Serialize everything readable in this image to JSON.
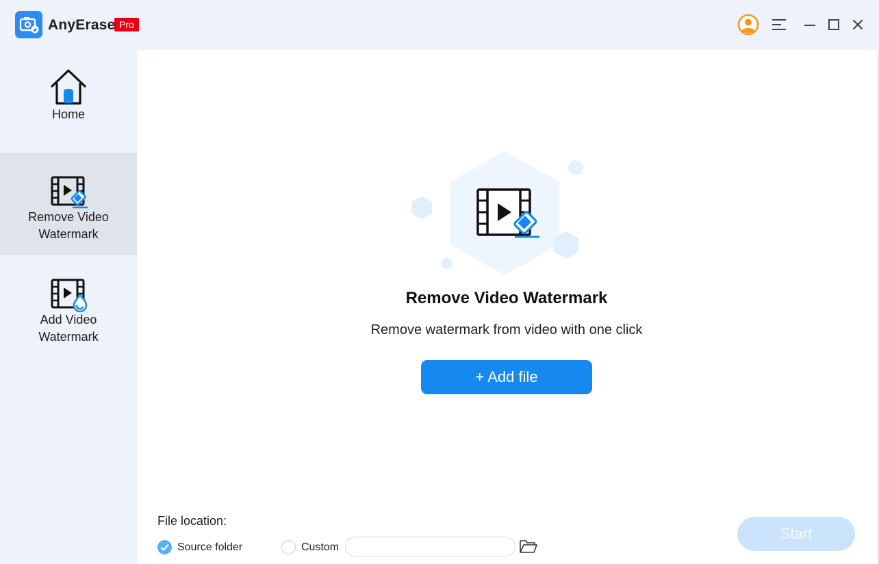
{
  "app": {
    "name": "AnyErase",
    "badge": "Pro"
  },
  "titlebar": {
    "icons": [
      "account-icon",
      "menu-icon",
      "minimize-icon",
      "maximize-icon",
      "close-icon"
    ]
  },
  "sidebar": {
    "items": [
      {
        "label": "Home",
        "icon": "home-icon",
        "active": false
      },
      {
        "label": "Remove Video\nWatermark",
        "icon": "remove-watermark-icon",
        "active": true
      },
      {
        "label": "Add Video\nWatermark",
        "icon": "add-watermark-icon",
        "active": false
      }
    ]
  },
  "main": {
    "title": "Remove Video Watermark",
    "subtitle": "Remove watermark from video with one click",
    "add_file_label": "+ Add file",
    "file_location_label": "File location:",
    "source_folder_label": "Source folder",
    "custom_label": "Custom",
    "custom_path_value": "",
    "start_label": "Start"
  },
  "colors": {
    "accent": "#1589ee",
    "badge": "#e60012",
    "sidebar_bg": "#eef2fa",
    "active_bg": "#dfe3ea",
    "start_disabled": "#cbe4fb"
  }
}
